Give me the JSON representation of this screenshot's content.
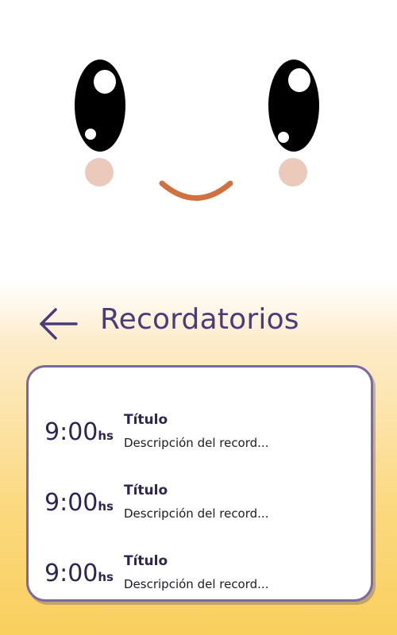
{
  "face": {
    "left_eye": "eye-icon",
    "right_eye": "eye-icon",
    "mouth": "smile-icon",
    "cheek_color": "#ebcabb",
    "mouth_color": "#cf7140",
    "eye_color": "#000000"
  },
  "header": {
    "back_icon": "arrow-left-icon",
    "title": "Recordatorios"
  },
  "reminders": [
    {
      "time": "9:00",
      "unit": "hs",
      "title": "Título",
      "description": "Descripción del record..."
    },
    {
      "time": "9:00",
      "unit": "hs",
      "title": "Título",
      "description": "Descripción del record..."
    },
    {
      "time": "9:00",
      "unit": "hs",
      "title": "Título",
      "description": "Descripción del record..."
    }
  ],
  "colors": {
    "accent": "#4b3b7a",
    "card_border": "#7a6aa3",
    "background_bottom": "#f9cf5e"
  }
}
